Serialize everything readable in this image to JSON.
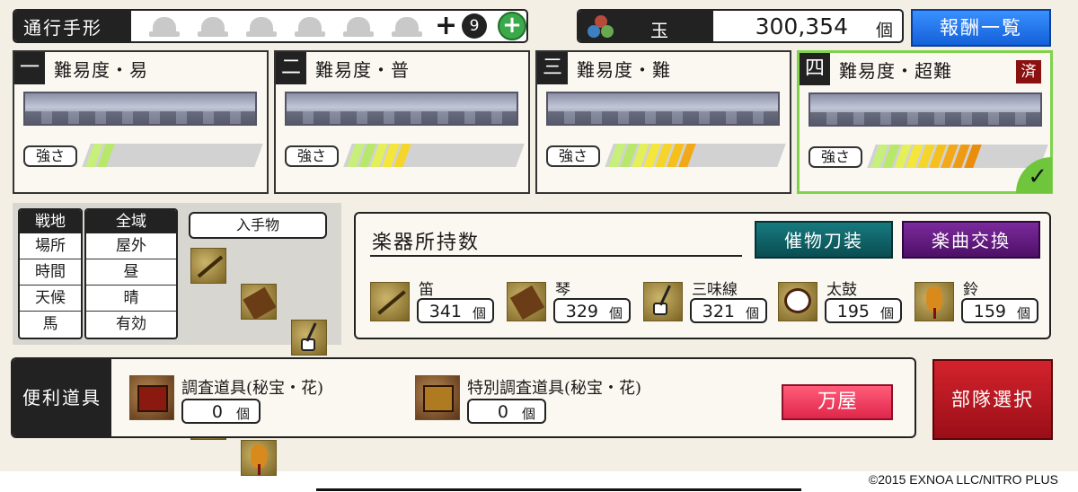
{
  "pass": {
    "label": "通行手形",
    "slots": 6,
    "plus": "+",
    "count": "9",
    "add_icon": "plus-circle-icon"
  },
  "currency": {
    "name": "玉",
    "value": "300,354",
    "unit": "個",
    "colors": [
      "#b84a3c",
      "#3d7fbf",
      "#6aa84f"
    ]
  },
  "reward_button": "報酬一覧",
  "difficulties": [
    {
      "num": "一",
      "title": "難易度・易",
      "strength_label": "強さ",
      "level": 2,
      "done": false
    },
    {
      "num": "二",
      "title": "難易度・普",
      "strength_label": "強さ",
      "level": 5,
      "done": false
    },
    {
      "num": "三",
      "title": "難易度・難",
      "strength_label": "強さ",
      "level": 7,
      "done": false
    },
    {
      "num": "四",
      "title": "難易度・超難",
      "strength_label": "強さ",
      "level": 9,
      "done": true,
      "done_label": "済",
      "check": "✓"
    }
  ],
  "conditions": {
    "header_left": "戦地",
    "header_right": "全域",
    "rows": [
      {
        "key": "場所",
        "value": "屋外"
      },
      {
        "key": "時間",
        "value": "昼"
      },
      {
        "key": "天候",
        "value": "晴"
      },
      {
        "key": "馬",
        "value": "有効"
      }
    ],
    "acquire_label": "入手物"
  },
  "instruments": {
    "title": "楽器所持数",
    "btn_event": "催物刀装",
    "btn_exchange": "楽曲交換",
    "items": [
      {
        "name": "笛",
        "count": "341",
        "unit": "個"
      },
      {
        "name": "琴",
        "count": "329",
        "unit": "個"
      },
      {
        "name": "三味線",
        "count": "321",
        "unit": "個"
      },
      {
        "name": "太鼓",
        "count": "195",
        "unit": "個"
      },
      {
        "name": "鈴",
        "count": "159",
        "unit": "個"
      }
    ]
  },
  "tools": {
    "label": "便利道具",
    "items": [
      {
        "name": "調査道具(秘宝・花)",
        "count": "0",
        "unit": "個"
      },
      {
        "name": "特別調査道具(秘宝・花)",
        "count": "0",
        "unit": "個"
      }
    ],
    "shop_button": "万屋"
  },
  "sortie_button": "部隊選択",
  "copyright": "©2015 EXNOA LLC/NITRO PLUS"
}
